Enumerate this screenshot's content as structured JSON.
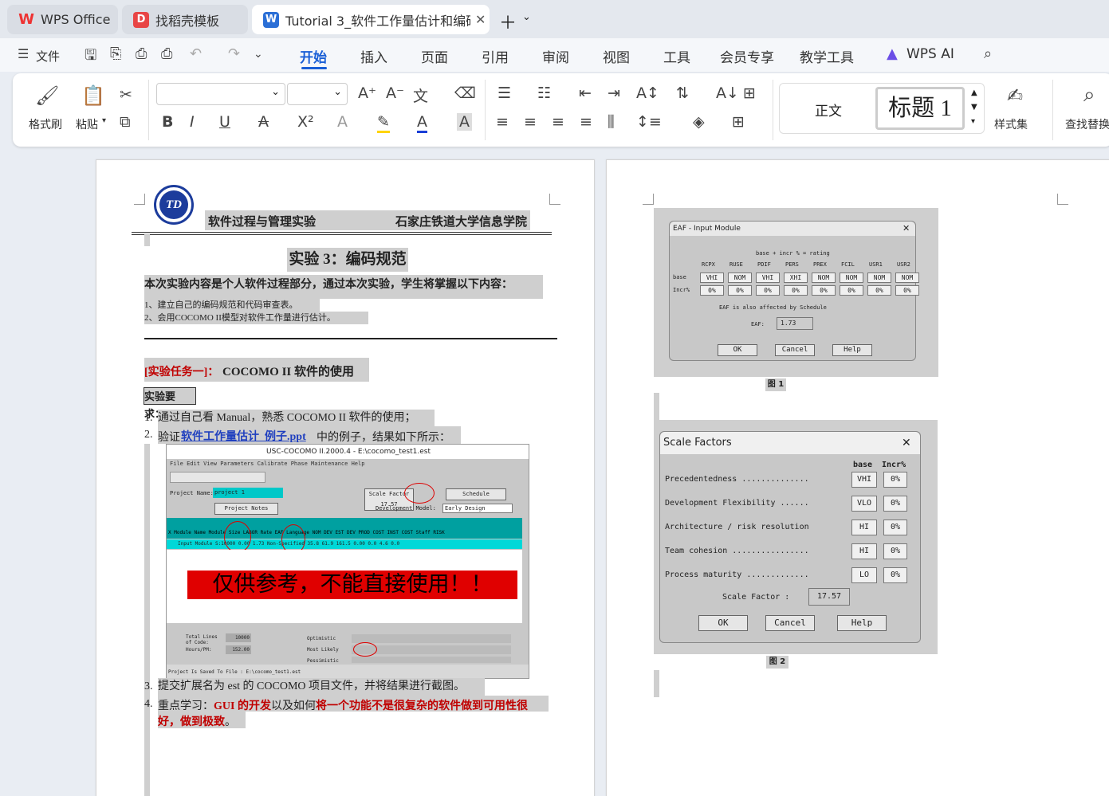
{
  "tabs": [
    {
      "label": "WPS Office"
    },
    {
      "label": "找稻壳模板"
    },
    {
      "label": "Tutorial 3_软件工作量估计和编码"
    }
  ],
  "menu": {
    "file": "文件",
    "items": [
      "开始",
      "插入",
      "页面",
      "引用",
      "审阅",
      "视图",
      "工具",
      "会员专享",
      "教学工具"
    ],
    "wps_ai": "WPS AI"
  },
  "ribbon": {
    "format_painter": "格式刷",
    "paste": "粘贴",
    "style_normal": "正文",
    "style_heading": "标题  1",
    "style_set": "样式集",
    "find_replace": "查找替换"
  },
  "doc": {
    "header_left": "软件过程与管理实验",
    "header_right": "石家庄铁道大学信息学院",
    "title": "实验 3：编码规范",
    "intro": "本次实验内容是个人软件过程部分，通过本次实验，学生将掌握以下内容：",
    "items": [
      "1、建立自己的编码规范和代码审查表。",
      "2、会用COCOMO II模型对软件工作量进行估计。"
    ],
    "task_prefix": "[实验任务一]：",
    "task_title": "COCOMO II  软件的使用",
    "req": "实验要求：",
    "l1": "通过自己看 Manual，熟悉 COCOMO II 软件的使用；",
    "l2a": "验证",
    "l2link": "软件工作量估计_例子.ppt",
    "l2b": "中的例子，结果如下所示：",
    "l3": "提交扩展名为 est 的 COCOMO 项目文件，并将结果进行截图。",
    "l4a": "重点学习：",
    "l4b": "GUI 的开发",
    "l4c": "以及如何",
    "l4d": "将一个功能不是很复杂的软件做到可用性很",
    "l4e": "好，做到极致",
    "l4f": "。",
    "nums": [
      "1.",
      "2.",
      "3.",
      "4."
    ]
  },
  "cocomo": {
    "title": "USC-COCOMO II.2000.4 - E:\\cocomo_test1.est",
    "menus": "File   Edit   View   Parameters   Calibrate   Phase   Maintenance   Help",
    "project_label": "Project Name:",
    "project": "project 1",
    "sf_label": "Scale Factor",
    "sf": "17.57",
    "schedule": "Schedule",
    "notes": "Project Notes",
    "dev_label": "Development Model:",
    "dev": "Early Design",
    "cols": "X   Module Name    Module Size   LABOR Rate   EAF   Language   NOM DEV   EST DEV   PROD   COST   INST COST   Staff   RISK",
    "row": "Input Module   S:10000   0.00   1.73   Non-Specified   35.8   61.9   161.5   0.00   0.0   4.6   0.0",
    "watermark": "仅供参考，不能直接使用！！",
    "total_label": "Total Lines of Code:",
    "total": "10000",
    "hours_label": "Hours/PM:",
    "hours": "152.00",
    "est": [
      "Optimistic",
      "Most Likely",
      "Pessimistic"
    ],
    "status": "Project Is Saved To File : E:\\cocomo_test1.est"
  },
  "eaf": {
    "title": "EAF - Input Module",
    "formula": "base + incr % = rating",
    "cols": [
      "RCPX",
      "RUSE",
      "PDIF",
      "PERS",
      "PREX",
      "FCIL",
      "USR1",
      "USR2"
    ],
    "base": [
      "VHI",
      "NOM",
      "VHI",
      "XHI",
      "NOM",
      "NOM",
      "NOM",
      "NOM"
    ],
    "incr": [
      "0%",
      "0%",
      "0%",
      "0%",
      "0%",
      "0%",
      "0%",
      "0%"
    ],
    "row_base": "base",
    "row_incr": "Incr%",
    "note": "EAF is also affected by Schedule",
    "eaf_label": "EAF:",
    "eaf": "1.73",
    "ok": "OK",
    "cancel": "Cancel",
    "help": "Help",
    "caption": "图 1"
  },
  "sf": {
    "title": "Scale Factors",
    "hdr_base": "base",
    "hdr_incr": "Incr%",
    "rows": [
      {
        "label": "Precedentedness ..............",
        "base": "VHI",
        "incr": "0%"
      },
      {
        "label": "Development Flexibility ......",
        "base": "VLO",
        "incr": "0%"
      },
      {
        "label": "Architecture / risk resolution",
        "base": "HI",
        "incr": "0%"
      },
      {
        "label": "Team cohesion ................",
        "base": "HI",
        "incr": "0%"
      },
      {
        "label": "Process maturity .............",
        "base": "LO",
        "incr": "0%"
      }
    ],
    "sf_label": "Scale Factor :",
    "sf": "17.57",
    "ok": "OK",
    "cancel": "Cancel",
    "help": "Help",
    "caption": "图 2"
  }
}
